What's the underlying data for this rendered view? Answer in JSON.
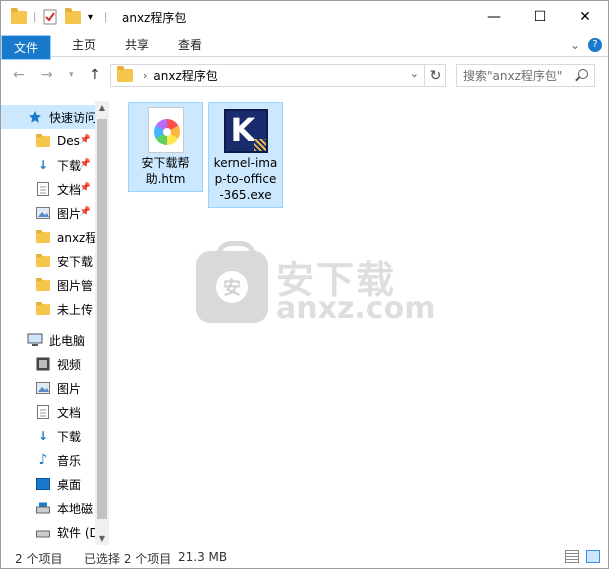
{
  "window": {
    "title": "anxz程序包",
    "controls": {
      "minimize": "—",
      "maximize": "☐",
      "close": "✕"
    }
  },
  "ribbon": {
    "tabs": [
      "文件",
      "主页",
      "共享",
      "查看"
    ],
    "expand_glyph": "⌄",
    "help_glyph": "?"
  },
  "address": {
    "path": "anxz程序包",
    "separator": "›",
    "search_placeholder": "搜索\"anxz程序包\""
  },
  "navpane": {
    "items": [
      {
        "label": "快速访问",
        "icon": "star-icon",
        "pinned": false,
        "selected": true
      },
      {
        "label": "Des",
        "icon": "folder-icon",
        "pinned": true
      },
      {
        "label": "下载",
        "icon": "download-arrow-icon",
        "pinned": true
      },
      {
        "label": "文档",
        "icon": "document-icon",
        "pinned": true
      },
      {
        "label": "图片",
        "icon": "picture-icon",
        "pinned": true
      },
      {
        "label": "anxz程",
        "icon": "folder-icon",
        "pinned": false
      },
      {
        "label": "安下载",
        "icon": "folder-icon",
        "pinned": false
      },
      {
        "label": "图片管",
        "icon": "folder-icon",
        "pinned": false
      },
      {
        "label": "未上传",
        "icon": "folder-icon",
        "pinned": false
      },
      {
        "label": "此电脑",
        "icon": "computer-icon",
        "pinned": false
      },
      {
        "label": "视频",
        "icon": "video-icon",
        "pinned": false
      },
      {
        "label": "图片",
        "icon": "picture-icon",
        "pinned": false
      },
      {
        "label": "文档",
        "icon": "document-icon",
        "pinned": false
      },
      {
        "label": "下载",
        "icon": "download-arrow-icon",
        "pinned": false
      },
      {
        "label": "音乐",
        "icon": "music-note-icon",
        "pinned": false
      },
      {
        "label": "桌面",
        "icon": "desktop-icon",
        "pinned": false
      },
      {
        "label": "本地磁",
        "icon": "drive-icon",
        "pinned": false
      },
      {
        "label": "软件 (D",
        "icon": "drive-icon",
        "pinned": false
      }
    ]
  },
  "files": [
    {
      "name": "安下载帮助.htm",
      "line1": "安下载帮",
      "line2": "助.htm",
      "icon": "htm-file-icon"
    },
    {
      "name": "kernel-imap-to-office-365.exe",
      "line1": "kernel-ima",
      "line2": "p-to-office",
      "line3": "-365.exe",
      "icon": "kernel-app-icon"
    }
  ],
  "watermark": {
    "logo_char": "安",
    "text_cn": "安下载",
    "text_en": "anxz.com"
  },
  "status": {
    "count": "2 个项目",
    "selection": "已选择 2 个项目",
    "size": "21.3 MB"
  }
}
